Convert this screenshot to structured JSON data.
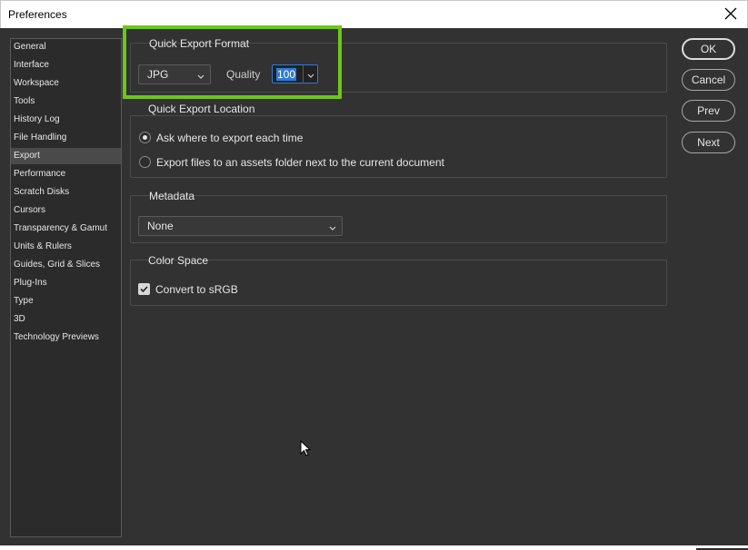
{
  "window": {
    "title": "Preferences"
  },
  "sidebar": {
    "items": [
      {
        "label": "General"
      },
      {
        "label": "Interface"
      },
      {
        "label": "Workspace"
      },
      {
        "label": "Tools"
      },
      {
        "label": "History Log"
      },
      {
        "label": "File Handling"
      },
      {
        "label": "Export",
        "selected": true
      },
      {
        "label": "Performance"
      },
      {
        "label": "Scratch Disks"
      },
      {
        "label": "Cursors"
      },
      {
        "label": "Transparency & Gamut"
      },
      {
        "label": "Units & Rulers"
      },
      {
        "label": "Guides, Grid & Slices"
      },
      {
        "label": "Plug-Ins"
      },
      {
        "label": "Type"
      },
      {
        "label": "3D"
      },
      {
        "label": "Technology Previews"
      }
    ]
  },
  "quick_export_format": {
    "title": "Quick Export Format",
    "format_value": "JPG",
    "quality_label": "Quality",
    "quality_value": "100"
  },
  "quick_export_location": {
    "title": "Quick Export Location",
    "options": [
      {
        "label": "Ask where to export each time",
        "selected": true
      },
      {
        "label": "Export files to an assets folder next to the current document",
        "selected": false
      }
    ]
  },
  "metadata": {
    "title": "Metadata",
    "value": "None"
  },
  "color_space": {
    "title": "Color Space",
    "checkbox_label": "Convert to sRGB",
    "checked": true
  },
  "buttons": {
    "ok": "OK",
    "cancel": "Cancel",
    "prev": "Prev",
    "next": "Next"
  },
  "colors": {
    "background": "#323232",
    "highlight": "#6fc51c",
    "selection": "#2f7bd6"
  }
}
